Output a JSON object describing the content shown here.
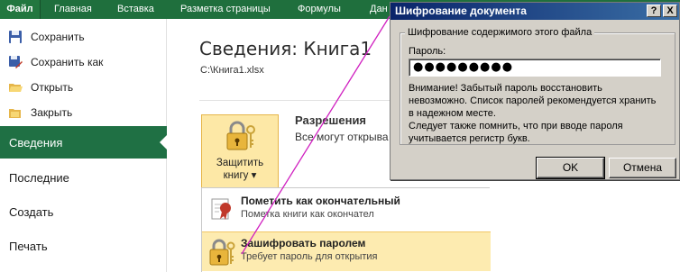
{
  "ribbon": {
    "tabs": [
      {
        "label": "Файл"
      },
      {
        "label": "Главная"
      },
      {
        "label": "Вставка"
      },
      {
        "label": "Разметка страницы"
      },
      {
        "label": "Формулы"
      },
      {
        "label": "Дан"
      }
    ]
  },
  "sidebar": {
    "items": [
      {
        "label": "Сохранить",
        "icon": "save-icon"
      },
      {
        "label": "Сохранить как",
        "icon": "save-as-icon"
      },
      {
        "label": "Открыть",
        "icon": "open-folder-icon"
      },
      {
        "label": "Закрыть",
        "icon": "close-file-icon"
      },
      {
        "label": "Сведения",
        "active": true
      },
      {
        "label": "Последние"
      },
      {
        "label": "Создать"
      },
      {
        "label": "Печать"
      }
    ]
  },
  "main": {
    "title": "Сведения: Книга1",
    "path": "C:\\Книга1.xlsx",
    "protect_button": {
      "line1": "Защитить",
      "line2": "книгу ▾"
    },
    "permissions": {
      "heading": "Разрешения",
      "description": "Все могут открыва"
    },
    "dropdown": [
      {
        "title": "Пометить как окончательный",
        "subtitle": "Пометка книги как окончател",
        "icon": "ribbon-stamp-icon"
      },
      {
        "title": "Зашифровать паролем",
        "subtitle": "Требует пароль для открытия",
        "icon": "lock-key-icon",
        "highlighted": true
      }
    ]
  },
  "dialog": {
    "title": "Шифрование документа",
    "help_label": "?",
    "close_label": "X",
    "group_label": "Шифрование содержимого этого файла",
    "password_label": "Пароль:",
    "password_value": "●●●●●●●●●",
    "warning_line1": "Внимание! Забытый пароль восстановить",
    "warning_line2": "невозможно. Список паролей рекомендуется хранить",
    "warning_line3": "в надежном месте.",
    "warning_line4": "Следует также помнить, что при вводе пароля",
    "warning_line5": "учитывается регистр букв.",
    "ok_label": "OK",
    "cancel_label": "Отмена"
  },
  "colors": {
    "ribbon_green": "#1f6f3d",
    "active_nav": "#1f7044",
    "highlight": "#fdebb0",
    "connector": "#d020c0"
  }
}
